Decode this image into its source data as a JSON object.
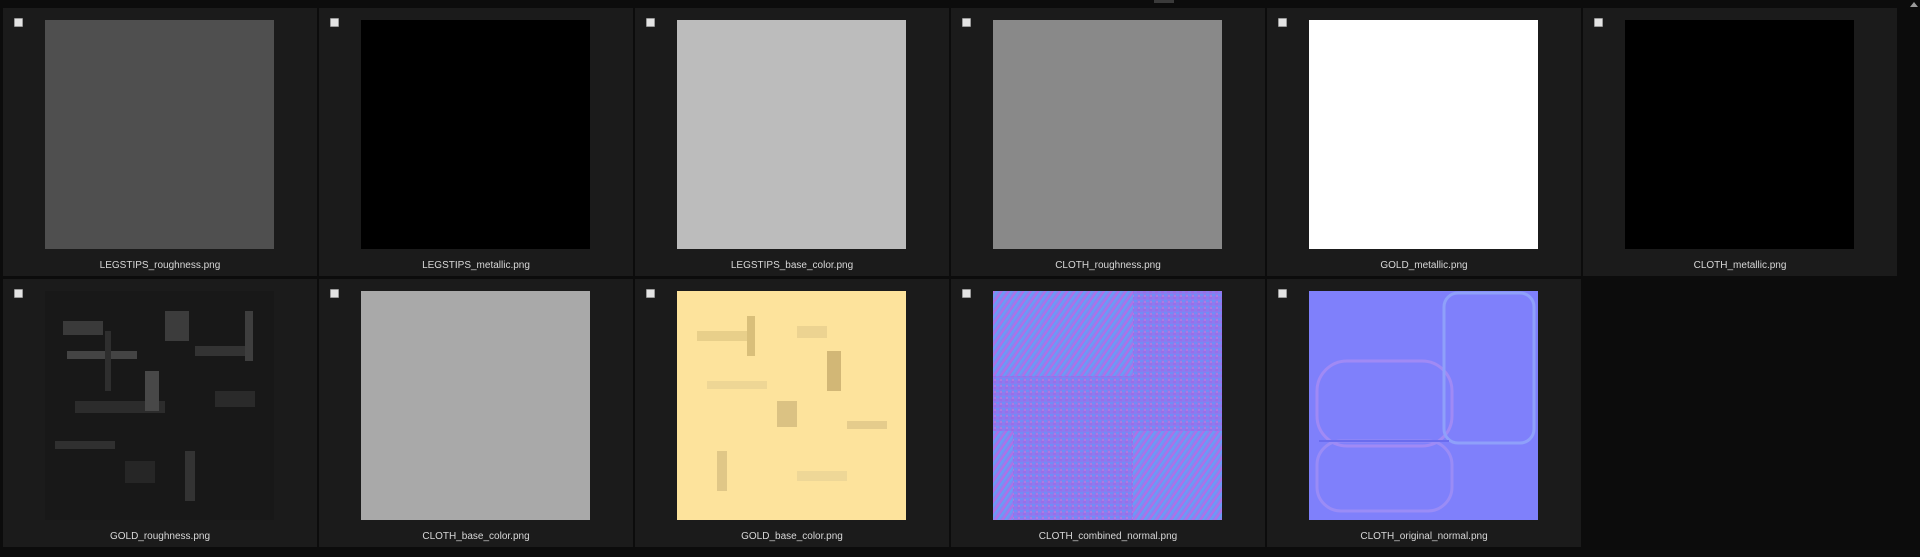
{
  "files": [
    {
      "name": "LEGSTIPS_roughness.png",
      "swatch": "#4f4f4f"
    },
    {
      "name": "LEGSTIPS_metallic.png",
      "swatch": "#000000"
    },
    {
      "name": "LEGSTIPS_base_color.png",
      "swatch": "#bcbcbc"
    },
    {
      "name": "CLOTH_roughness.png",
      "swatch": "#898989"
    },
    {
      "name": "GOLD_metallic.png",
      "swatch": "#ffffff"
    },
    {
      "name": "CLOTH_metallic.png",
      "swatch": "#000000"
    },
    {
      "name": "GOLD_roughness.png",
      "swatch": "#181818"
    },
    {
      "name": "CLOTH_base_color.png",
      "swatch": "#a9a9a9"
    },
    {
      "name": "GOLD_base_color.png",
      "swatch": "#fde39c"
    },
    {
      "name": "CLOTH_combined_normal.png",
      "swatch": "#8a7cf0"
    },
    {
      "name": "CLOTH_original_normal.png",
      "swatch": "#7f80fb"
    }
  ]
}
